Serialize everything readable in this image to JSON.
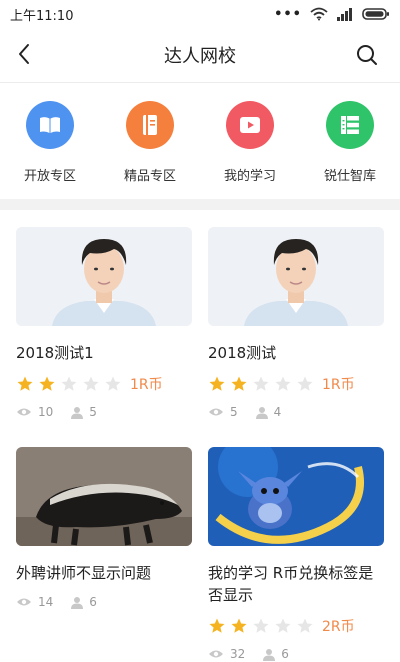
{
  "status_bar": {
    "time": "上午11:10",
    "more": "•••"
  },
  "nav": {
    "title": "达人网校",
    "back_icon": "back-arrow-icon",
    "search_icon": "search-icon"
  },
  "categories": [
    {
      "label": "开放专区",
      "icon": "book-icon",
      "color": "#4f93f0"
    },
    {
      "label": "精品专区",
      "icon": "notebook-icon",
      "color": "#f5803e"
    },
    {
      "label": "我的学习",
      "icon": "play-icon",
      "color": "#f25a63"
    },
    {
      "label": "锐仕智库",
      "icon": "library-icon",
      "color": "#2fc46a"
    }
  ],
  "courses": [
    {
      "title": "2018测试1",
      "image": "portrait",
      "rating": 2,
      "max_rating": 5,
      "price": "1R币",
      "views": "10",
      "learners": "5"
    },
    {
      "title": "2018测试",
      "image": "portrait",
      "rating": 2,
      "max_rating": 5,
      "price": "1R币",
      "views": "5",
      "learners": "4"
    },
    {
      "title": "外聘讲师不显示问题",
      "image": "honey-badger",
      "views": "14",
      "learners": "6"
    },
    {
      "title": "我的学习 R币兑换标签是否显示",
      "image": "cartoon-stitch",
      "rating": 2,
      "max_rating": 5,
      "price": "2R币",
      "views": "32",
      "learners": "6"
    }
  ],
  "colors": {
    "star_on": "#f6b321",
    "star_off": "#e6e6e6",
    "price": "#f08a4b",
    "meta": "#999999"
  }
}
